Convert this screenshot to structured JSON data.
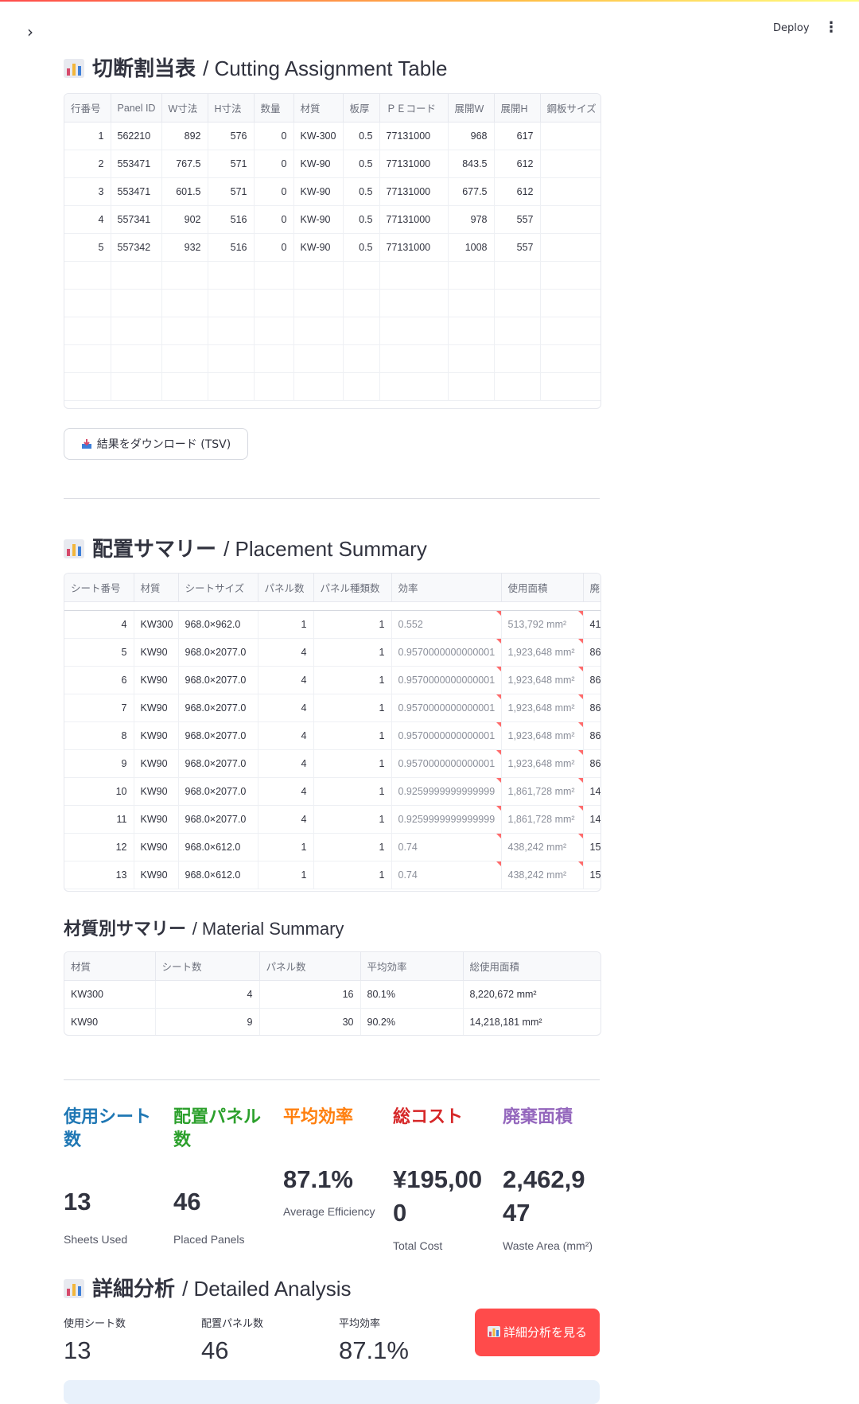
{
  "header": {
    "deploy_label": "Deploy"
  },
  "cutting": {
    "title_jp": "切断割当表",
    "title_en": "/ Cutting Assignment Table",
    "columns": [
      "行番号",
      "Panel ID",
      "W寸法",
      "H寸法",
      "数量",
      "材質",
      "板厚",
      "ＰＥコード",
      "展開W",
      "展開H",
      "鋼板サイズ"
    ],
    "rows": [
      [
        "1",
        "562210",
        "892",
        "576",
        "0",
        "KW-300",
        "0.5",
        "77131000",
        "968",
        "617",
        ""
      ],
      [
        "2",
        "553471",
        "767.5",
        "571",
        "0",
        "KW-90",
        "0.5",
        "77131000",
        "843.5",
        "612",
        ""
      ],
      [
        "3",
        "553471",
        "601.5",
        "571",
        "0",
        "KW-90",
        "0.5",
        "77131000",
        "677.5",
        "612",
        ""
      ],
      [
        "4",
        "557341",
        "902",
        "516",
        "0",
        "KW-90",
        "0.5",
        "77131000",
        "978",
        "557",
        ""
      ],
      [
        "5",
        "557342",
        "932",
        "516",
        "0",
        "KW-90",
        "0.5",
        "77131000",
        "1008",
        "557",
        ""
      ]
    ],
    "download_label": "結果をダウンロード (TSV)"
  },
  "placement": {
    "title_jp": "配置サマリー",
    "title_en": "/ Placement Summary",
    "columns": [
      "シート番号",
      "材質",
      "シートサイズ",
      "パネル数",
      "パネル種類数",
      "効率",
      "使用面積",
      "廃"
    ],
    "rows": [
      [
        "4",
        "KW300",
        "968.0×962.0",
        "1",
        "1",
        "0.552",
        "513,792 mm²",
        "41"
      ],
      [
        "5",
        "KW90",
        "968.0×2077.0",
        "4",
        "1",
        "0.9570000000000001",
        "1,923,648 mm²",
        "86"
      ],
      [
        "6",
        "KW90",
        "968.0×2077.0",
        "4",
        "1",
        "0.9570000000000001",
        "1,923,648 mm²",
        "86"
      ],
      [
        "7",
        "KW90",
        "968.0×2077.0",
        "4",
        "1",
        "0.9570000000000001",
        "1,923,648 mm²",
        "86"
      ],
      [
        "8",
        "KW90",
        "968.0×2077.0",
        "4",
        "1",
        "0.9570000000000001",
        "1,923,648 mm²",
        "86"
      ],
      [
        "9",
        "KW90",
        "968.0×2077.0",
        "4",
        "1",
        "0.9570000000000001",
        "1,923,648 mm²",
        "86"
      ],
      [
        "10",
        "KW90",
        "968.0×2077.0",
        "4",
        "1",
        "0.9259999999999999",
        "1,861,728 mm²",
        "14"
      ],
      [
        "11",
        "KW90",
        "968.0×2077.0",
        "4",
        "1",
        "0.9259999999999999",
        "1,861,728 mm²",
        "14"
      ],
      [
        "12",
        "KW90",
        "968.0×612.0",
        "1",
        "1",
        "0.74",
        "438,242 mm²",
        "15"
      ],
      [
        "13",
        "KW90",
        "968.0×612.0",
        "1",
        "1",
        "0.74",
        "438,242 mm²",
        "15"
      ]
    ]
  },
  "material": {
    "title_jp": "材質別サマリー",
    "title_en": "/ Material Summary",
    "columns": [
      "材質",
      "シート数",
      "パネル数",
      "平均効率",
      "総使用面積"
    ],
    "rows": [
      [
        "KW300",
        "4",
        "16",
        "80.1%",
        "8,220,672 mm²"
      ],
      [
        "KW90",
        "9",
        "30",
        "90.2%",
        "14,218,181 mm²"
      ]
    ]
  },
  "metrics": [
    {
      "label": "使用シート数",
      "value": "13",
      "sub": "Sheets Used",
      "color": "#1f77b4"
    },
    {
      "label": "配置パネル数",
      "value": "46",
      "sub": "Placed Panels",
      "color": "#2ca02c"
    },
    {
      "label": "平均効率",
      "value": "87.1%",
      "sub": "Average Efficiency",
      "color": "#ff7f0e"
    },
    {
      "label": "総コスト",
      "value": "¥195,000",
      "sub": "Total Cost",
      "color": "#d62728"
    },
    {
      "label": "廃棄面積",
      "value": "2,462,947",
      "sub": "Waste Area (mm²)",
      "color": "#9467bd"
    }
  ],
  "analysis": {
    "title_jp": "詳細分析",
    "title_en": "/ Detailed Analysis",
    "items": [
      {
        "label": "使用シート数",
        "value": "13"
      },
      {
        "label": "配置パネル数",
        "value": "46"
      },
      {
        "label": "平均効率",
        "value": "87.1%"
      }
    ],
    "button_label": "詳細分析を見る"
  }
}
